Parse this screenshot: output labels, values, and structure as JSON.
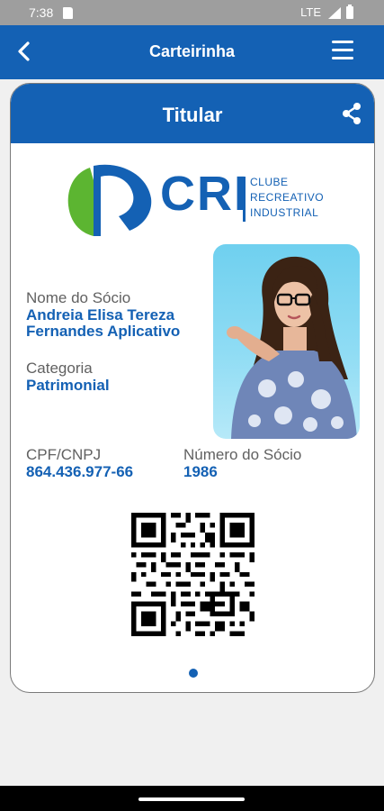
{
  "status_bar": {
    "time": "7:38",
    "network": "LTE",
    "icons": [
      "sd-card-icon",
      "signal-icon",
      "battery-icon"
    ]
  },
  "app_bar": {
    "title": "Carteirinha",
    "back_icon": "arrow-back-icon",
    "menu_icon": "hamburger-menu-icon"
  },
  "card": {
    "header_title": "Titular",
    "share_icon": "share-icon",
    "logo": {
      "acronym": "CRI",
      "line1": "CLUBE",
      "line2": "RECREATIVO",
      "line3": "INDUSTRIAL"
    },
    "member": {
      "name_label": "Nome do Sócio",
      "name_line1": "Andreia Elisa Tereza",
      "name_line2": "Fernandes Aplicativo",
      "category_label": "Categoria",
      "category_value": "Patrimonial",
      "cpf_label": "CPF/CNPJ",
      "cpf_value": "864.436.977-66",
      "number_label": "Número do Sócio",
      "number_value": "1986"
    }
  },
  "colors": {
    "brand_blue": "#1461b4",
    "logo_green": "#5cb531",
    "label_gray": "#616161"
  }
}
